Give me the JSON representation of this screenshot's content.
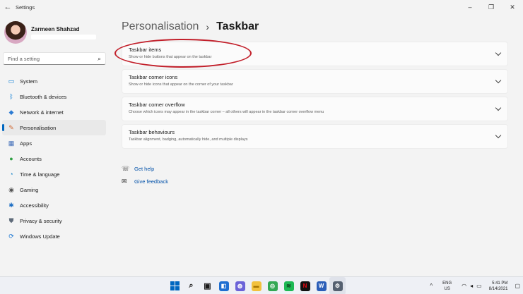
{
  "window": {
    "back_glyph": "←",
    "title": "Settings",
    "minimize_glyph": "–",
    "maximize_glyph": "❐",
    "close_glyph": "✕"
  },
  "profile": {
    "name": "Zarmeen Shahzad"
  },
  "search": {
    "placeholder": "Find a setting",
    "icon": "search-icon",
    "icon_glyph": "⌕"
  },
  "sidebar": {
    "items": [
      {
        "label": "System",
        "icon": "monitor-icon",
        "glyph": "▭",
        "color": "#0078d4"
      },
      {
        "label": "Bluetooth & devices",
        "icon": "bluetooth-icon",
        "glyph": "ᛒ",
        "color": "#0078d4"
      },
      {
        "label": "Network & internet",
        "icon": "wifi-icon",
        "glyph": "◆",
        "color": "#2b7bd3"
      },
      {
        "label": "Personalisation",
        "icon": "brush-icon",
        "glyph": "✎",
        "color": "#d06a36",
        "selected": true
      },
      {
        "label": "Apps",
        "icon": "apps-icon",
        "glyph": "▦",
        "color": "#3f6cb8"
      },
      {
        "label": "Accounts",
        "icon": "person-icon",
        "glyph": "●",
        "color": "#2ea043"
      },
      {
        "label": "Time & language",
        "icon": "globe-clock-icon",
        "glyph": "◔",
        "color": "#1e88c9"
      },
      {
        "label": "Gaming",
        "icon": "gamepad-icon",
        "glyph": "◉",
        "color": "#555555"
      },
      {
        "label": "Accessibility",
        "icon": "accessibility-icon",
        "glyph": "✱",
        "color": "#1e6fc4"
      },
      {
        "label": "Privacy & security",
        "icon": "shield-icon",
        "glyph": "⛊",
        "color": "#5f6b7a"
      },
      {
        "label": "Windows Update",
        "icon": "update-icon",
        "glyph": "⟳",
        "color": "#1e78d2"
      }
    ]
  },
  "main": {
    "breadcrumb_parent": "Personalisation",
    "breadcrumb_sep": "›",
    "page_title": "Taskbar",
    "cards": [
      {
        "title": "Taskbar items",
        "description": "Show or hide buttons that appear on the taskbar"
      },
      {
        "title": "Taskbar corner icons",
        "description": "Show or hide icons that appear on the corner of your taskbar"
      },
      {
        "title": "Taskbar corner overflow",
        "description": "Choose which icons may appear in the taskbar corner – all others will appear in the taskbar corner overflow menu"
      },
      {
        "title": "Taskbar behaviours",
        "description": "Taskbar alignment, badging, automatically hide, and multiple displays"
      }
    ],
    "links": [
      {
        "label": "Get help",
        "icon": "help-icon",
        "glyph": "☏"
      },
      {
        "label": "Give feedback",
        "icon": "feedback-icon",
        "glyph": "✉"
      }
    ]
  },
  "taskbar": {
    "apps": [
      {
        "icon": "start-icon"
      },
      {
        "icon": "search-icon",
        "glyph": "⌕",
        "bg": "transparent",
        "fg": "#1a1a1a"
      },
      {
        "icon": "task-view-icon",
        "glyph": "▣",
        "bg": "transparent",
        "fg": "#1a1a1a"
      },
      {
        "icon": "widgets-icon",
        "glyph": "◧",
        "bg": "#1f6fd1",
        "fg": "#ffffff"
      },
      {
        "icon": "chat-icon",
        "glyph": "◍",
        "bg": "#6b63d8",
        "fg": "#ffffff"
      },
      {
        "icon": "file-explorer-icon",
        "glyph": "▬",
        "bg": "#f2c13d",
        "fg": "#a57400"
      },
      {
        "icon": "chrome-icon",
        "glyph": "◎",
        "bg": "#34a853",
        "fg": "#ffffff"
      },
      {
        "icon": "spotify-icon",
        "glyph": "≋",
        "bg": "#1db954",
        "fg": "#0b3b1c"
      },
      {
        "icon": "netflix-icon",
        "glyph": "N",
        "bg": "#111111",
        "fg": "#e50914"
      },
      {
        "icon": "word-icon",
        "glyph": "W",
        "bg": "#2b5eb8",
        "fg": "#ffffff"
      },
      {
        "icon": "settings-gear-icon",
        "glyph": "⚙",
        "bg": "#556070",
        "fg": "#ffffff",
        "active": true
      }
    ],
    "tray": {
      "chevron": "^",
      "lang_top": "ENG",
      "lang_bottom": "US",
      "wifi_glyph": "◠",
      "volume_glyph": "◂",
      "battery_glyph": "▭",
      "time": "5:41 PM",
      "date": "8/14/2021",
      "notification_glyph": "▢"
    }
  }
}
